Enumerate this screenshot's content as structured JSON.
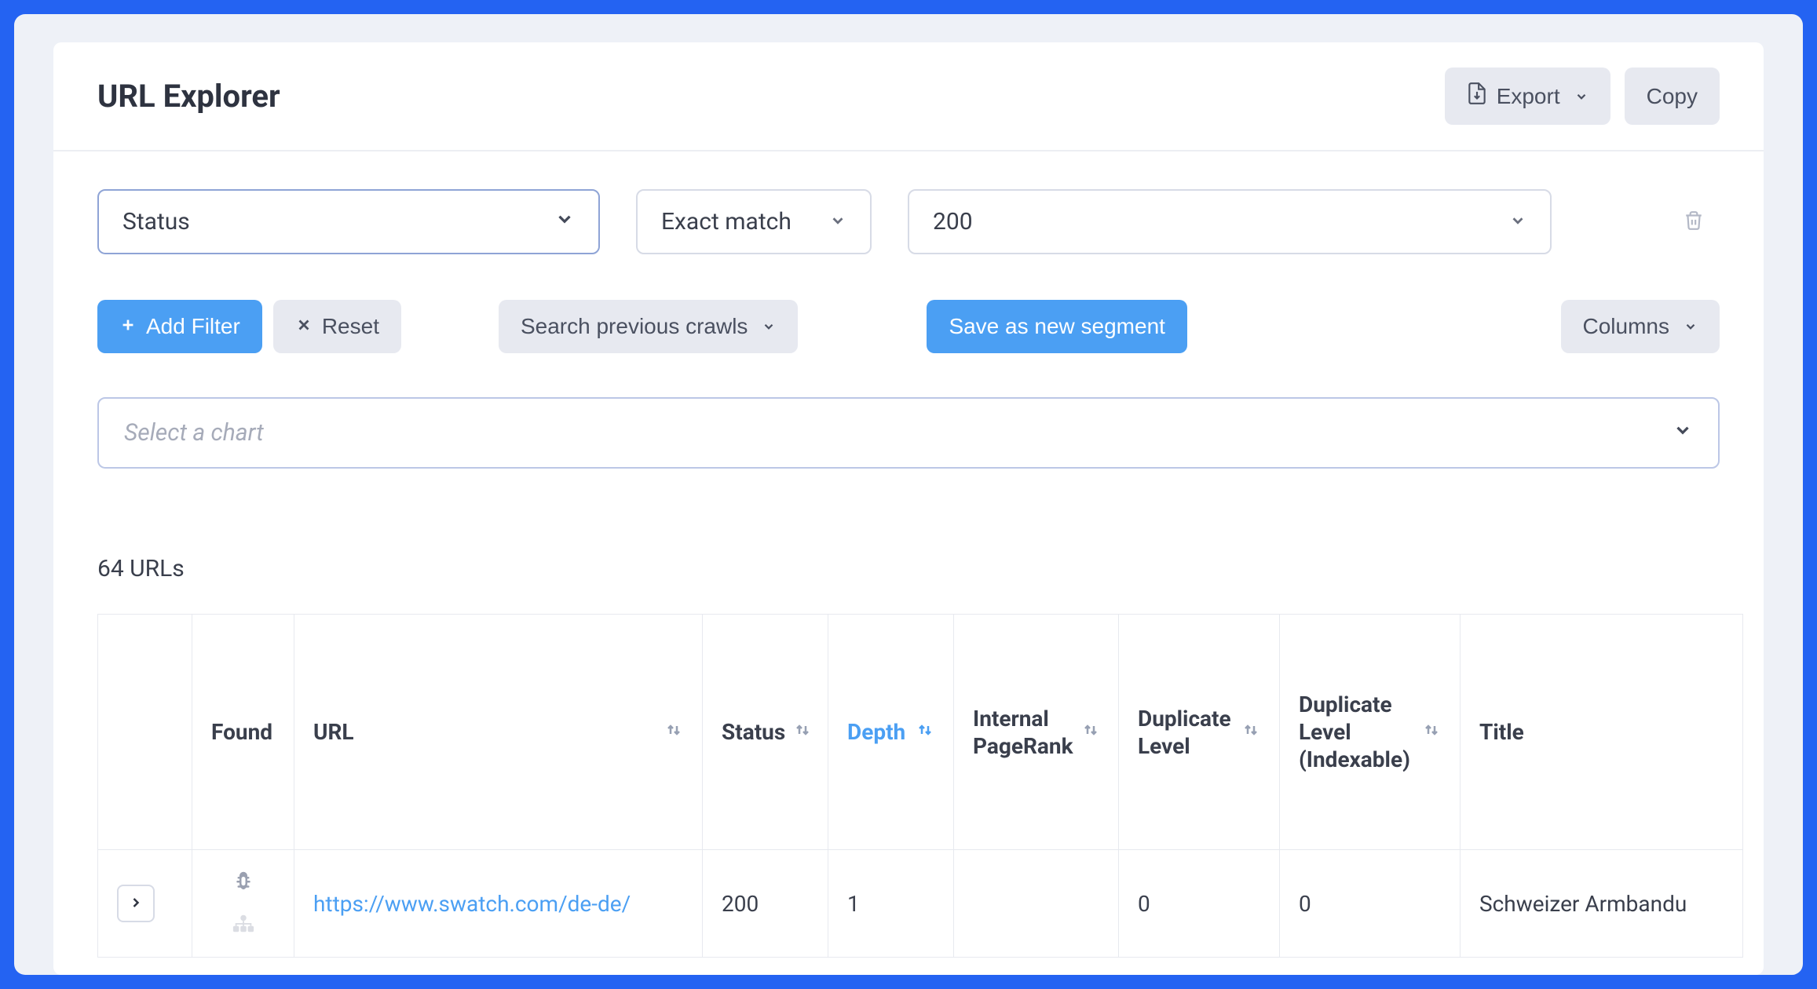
{
  "header": {
    "title": "URL Explorer",
    "export_label": "Export",
    "copy_label": "Copy"
  },
  "filter": {
    "field": "Status",
    "match_mode": "Exact match",
    "value": "200"
  },
  "actions": {
    "add_filter": "Add Filter",
    "reset": "Reset",
    "search_previous": "Search previous crawls",
    "save_segment": "Save as new segment",
    "columns": "Columns"
  },
  "chart_select_placeholder": "Select a chart",
  "results_count": "64 URLs",
  "columns": {
    "found": "Found",
    "url": "URL",
    "status": "Status",
    "depth": "Depth",
    "internal_pagerank": "Internal PageRank",
    "duplicate_level": "Duplicate Level",
    "duplicate_level_indexable": "Duplicate Level (Indexable)",
    "title": "Title"
  },
  "rows": [
    {
      "url": "https://www.swatch.com/de-de/",
      "status": "200",
      "depth": "1",
      "internal_pagerank": "",
      "duplicate_level": "0",
      "duplicate_level_indexable": "0",
      "title": "Schweizer Armbandu"
    }
  ]
}
